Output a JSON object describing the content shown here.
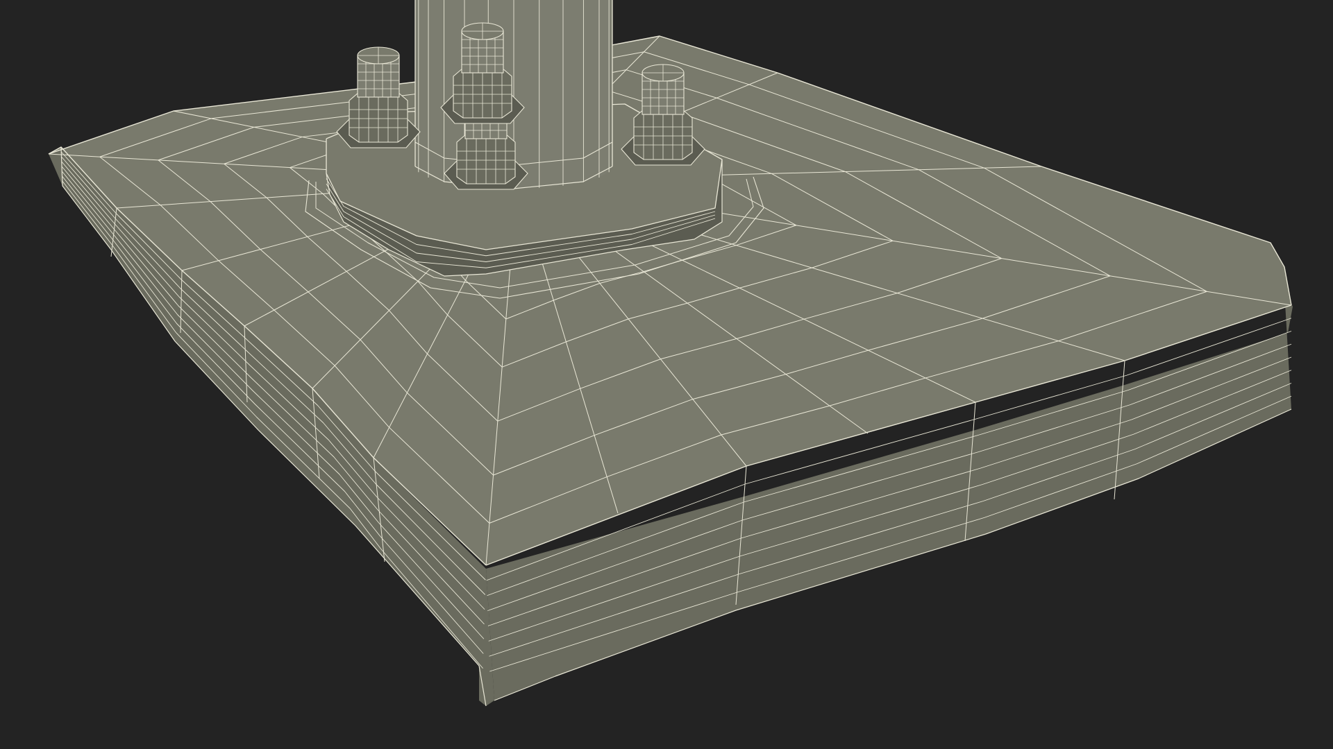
{
  "viewport": {
    "subject": "wireframe-render-of-bolted-column-base-plate",
    "background_color": "#232323"
  },
  "colors": {
    "surface_top": "#797A6C",
    "surface_side": "#6A6B5E",
    "surface_dark": "#5B5C51",
    "column": "#7C7D70",
    "wire": "#E9E7D6"
  },
  "mesh": {
    "bolts": 4,
    "slab_side_bevel_lines": 7,
    "column_segments": 12
  }
}
